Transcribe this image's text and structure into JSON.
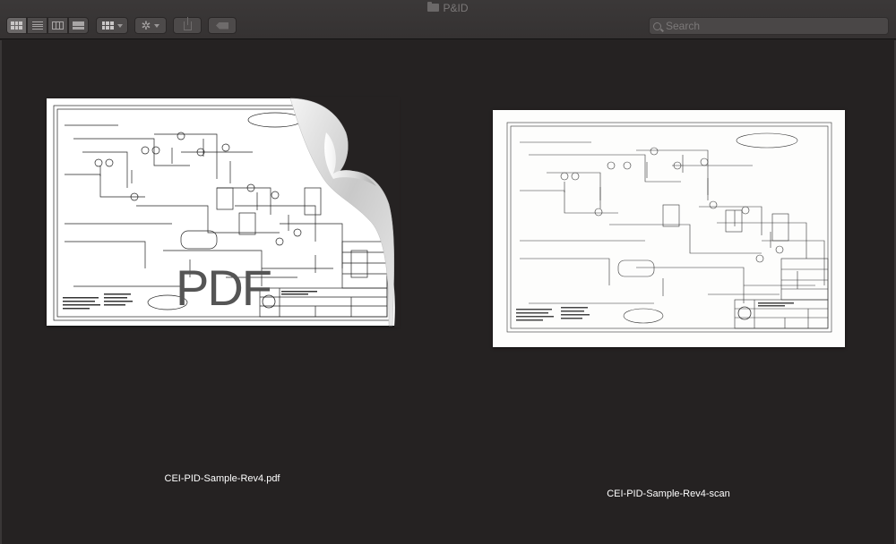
{
  "window": {
    "title": "P&ID"
  },
  "toolbar": {
    "view_buttons": [
      "icon-view",
      "list-view",
      "column-view",
      "cover-flow-view"
    ],
    "selected_view": "icon-view",
    "search": {
      "placeholder": "Search",
      "value": ""
    }
  },
  "files": [
    {
      "name": "CEI-PID-Sample-Rev4.pdf",
      "badge": "PDF"
    },
    {
      "name": "CEI-PID-Sample-Rev4-scan"
    }
  ]
}
